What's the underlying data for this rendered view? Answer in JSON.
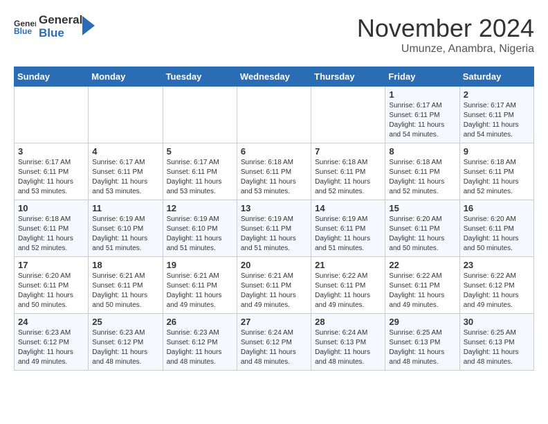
{
  "header": {
    "logo_general": "General",
    "logo_blue": "Blue",
    "month": "November 2024",
    "location": "Umunze, Anambra, Nigeria"
  },
  "weekdays": [
    "Sunday",
    "Monday",
    "Tuesday",
    "Wednesday",
    "Thursday",
    "Friday",
    "Saturday"
  ],
  "weeks": [
    [
      {
        "day": "",
        "info": ""
      },
      {
        "day": "",
        "info": ""
      },
      {
        "day": "",
        "info": ""
      },
      {
        "day": "",
        "info": ""
      },
      {
        "day": "",
        "info": ""
      },
      {
        "day": "1",
        "info": "Sunrise: 6:17 AM\nSunset: 6:11 PM\nDaylight: 11 hours\nand 54 minutes."
      },
      {
        "day": "2",
        "info": "Sunrise: 6:17 AM\nSunset: 6:11 PM\nDaylight: 11 hours\nand 54 minutes."
      }
    ],
    [
      {
        "day": "3",
        "info": "Sunrise: 6:17 AM\nSunset: 6:11 PM\nDaylight: 11 hours\nand 53 minutes."
      },
      {
        "day": "4",
        "info": "Sunrise: 6:17 AM\nSunset: 6:11 PM\nDaylight: 11 hours\nand 53 minutes."
      },
      {
        "day": "5",
        "info": "Sunrise: 6:17 AM\nSunset: 6:11 PM\nDaylight: 11 hours\nand 53 minutes."
      },
      {
        "day": "6",
        "info": "Sunrise: 6:18 AM\nSunset: 6:11 PM\nDaylight: 11 hours\nand 53 minutes."
      },
      {
        "day": "7",
        "info": "Sunrise: 6:18 AM\nSunset: 6:11 PM\nDaylight: 11 hours\nand 52 minutes."
      },
      {
        "day": "8",
        "info": "Sunrise: 6:18 AM\nSunset: 6:11 PM\nDaylight: 11 hours\nand 52 minutes."
      },
      {
        "day": "9",
        "info": "Sunrise: 6:18 AM\nSunset: 6:11 PM\nDaylight: 11 hours\nand 52 minutes."
      }
    ],
    [
      {
        "day": "10",
        "info": "Sunrise: 6:18 AM\nSunset: 6:11 PM\nDaylight: 11 hours\nand 52 minutes."
      },
      {
        "day": "11",
        "info": "Sunrise: 6:19 AM\nSunset: 6:10 PM\nDaylight: 11 hours\nand 51 minutes."
      },
      {
        "day": "12",
        "info": "Sunrise: 6:19 AM\nSunset: 6:10 PM\nDaylight: 11 hours\nand 51 minutes."
      },
      {
        "day": "13",
        "info": "Sunrise: 6:19 AM\nSunset: 6:11 PM\nDaylight: 11 hours\nand 51 minutes."
      },
      {
        "day": "14",
        "info": "Sunrise: 6:19 AM\nSunset: 6:11 PM\nDaylight: 11 hours\nand 51 minutes."
      },
      {
        "day": "15",
        "info": "Sunrise: 6:20 AM\nSunset: 6:11 PM\nDaylight: 11 hours\nand 50 minutes."
      },
      {
        "day": "16",
        "info": "Sunrise: 6:20 AM\nSunset: 6:11 PM\nDaylight: 11 hours\nand 50 minutes."
      }
    ],
    [
      {
        "day": "17",
        "info": "Sunrise: 6:20 AM\nSunset: 6:11 PM\nDaylight: 11 hours\nand 50 minutes."
      },
      {
        "day": "18",
        "info": "Sunrise: 6:21 AM\nSunset: 6:11 PM\nDaylight: 11 hours\nand 50 minutes."
      },
      {
        "day": "19",
        "info": "Sunrise: 6:21 AM\nSunset: 6:11 PM\nDaylight: 11 hours\nand 49 minutes."
      },
      {
        "day": "20",
        "info": "Sunrise: 6:21 AM\nSunset: 6:11 PM\nDaylight: 11 hours\nand 49 minutes."
      },
      {
        "day": "21",
        "info": "Sunrise: 6:22 AM\nSunset: 6:11 PM\nDaylight: 11 hours\nand 49 minutes."
      },
      {
        "day": "22",
        "info": "Sunrise: 6:22 AM\nSunset: 6:11 PM\nDaylight: 11 hours\nand 49 minutes."
      },
      {
        "day": "23",
        "info": "Sunrise: 6:22 AM\nSunset: 6:12 PM\nDaylight: 11 hours\nand 49 minutes."
      }
    ],
    [
      {
        "day": "24",
        "info": "Sunrise: 6:23 AM\nSunset: 6:12 PM\nDaylight: 11 hours\nand 49 minutes."
      },
      {
        "day": "25",
        "info": "Sunrise: 6:23 AM\nSunset: 6:12 PM\nDaylight: 11 hours\nand 48 minutes."
      },
      {
        "day": "26",
        "info": "Sunrise: 6:23 AM\nSunset: 6:12 PM\nDaylight: 11 hours\nand 48 minutes."
      },
      {
        "day": "27",
        "info": "Sunrise: 6:24 AM\nSunset: 6:12 PM\nDaylight: 11 hours\nand 48 minutes."
      },
      {
        "day": "28",
        "info": "Sunrise: 6:24 AM\nSunset: 6:13 PM\nDaylight: 11 hours\nand 48 minutes."
      },
      {
        "day": "29",
        "info": "Sunrise: 6:25 AM\nSunset: 6:13 PM\nDaylight: 11 hours\nand 48 minutes."
      },
      {
        "day": "30",
        "info": "Sunrise: 6:25 AM\nSunset: 6:13 PM\nDaylight: 11 hours\nand 48 minutes."
      }
    ]
  ]
}
